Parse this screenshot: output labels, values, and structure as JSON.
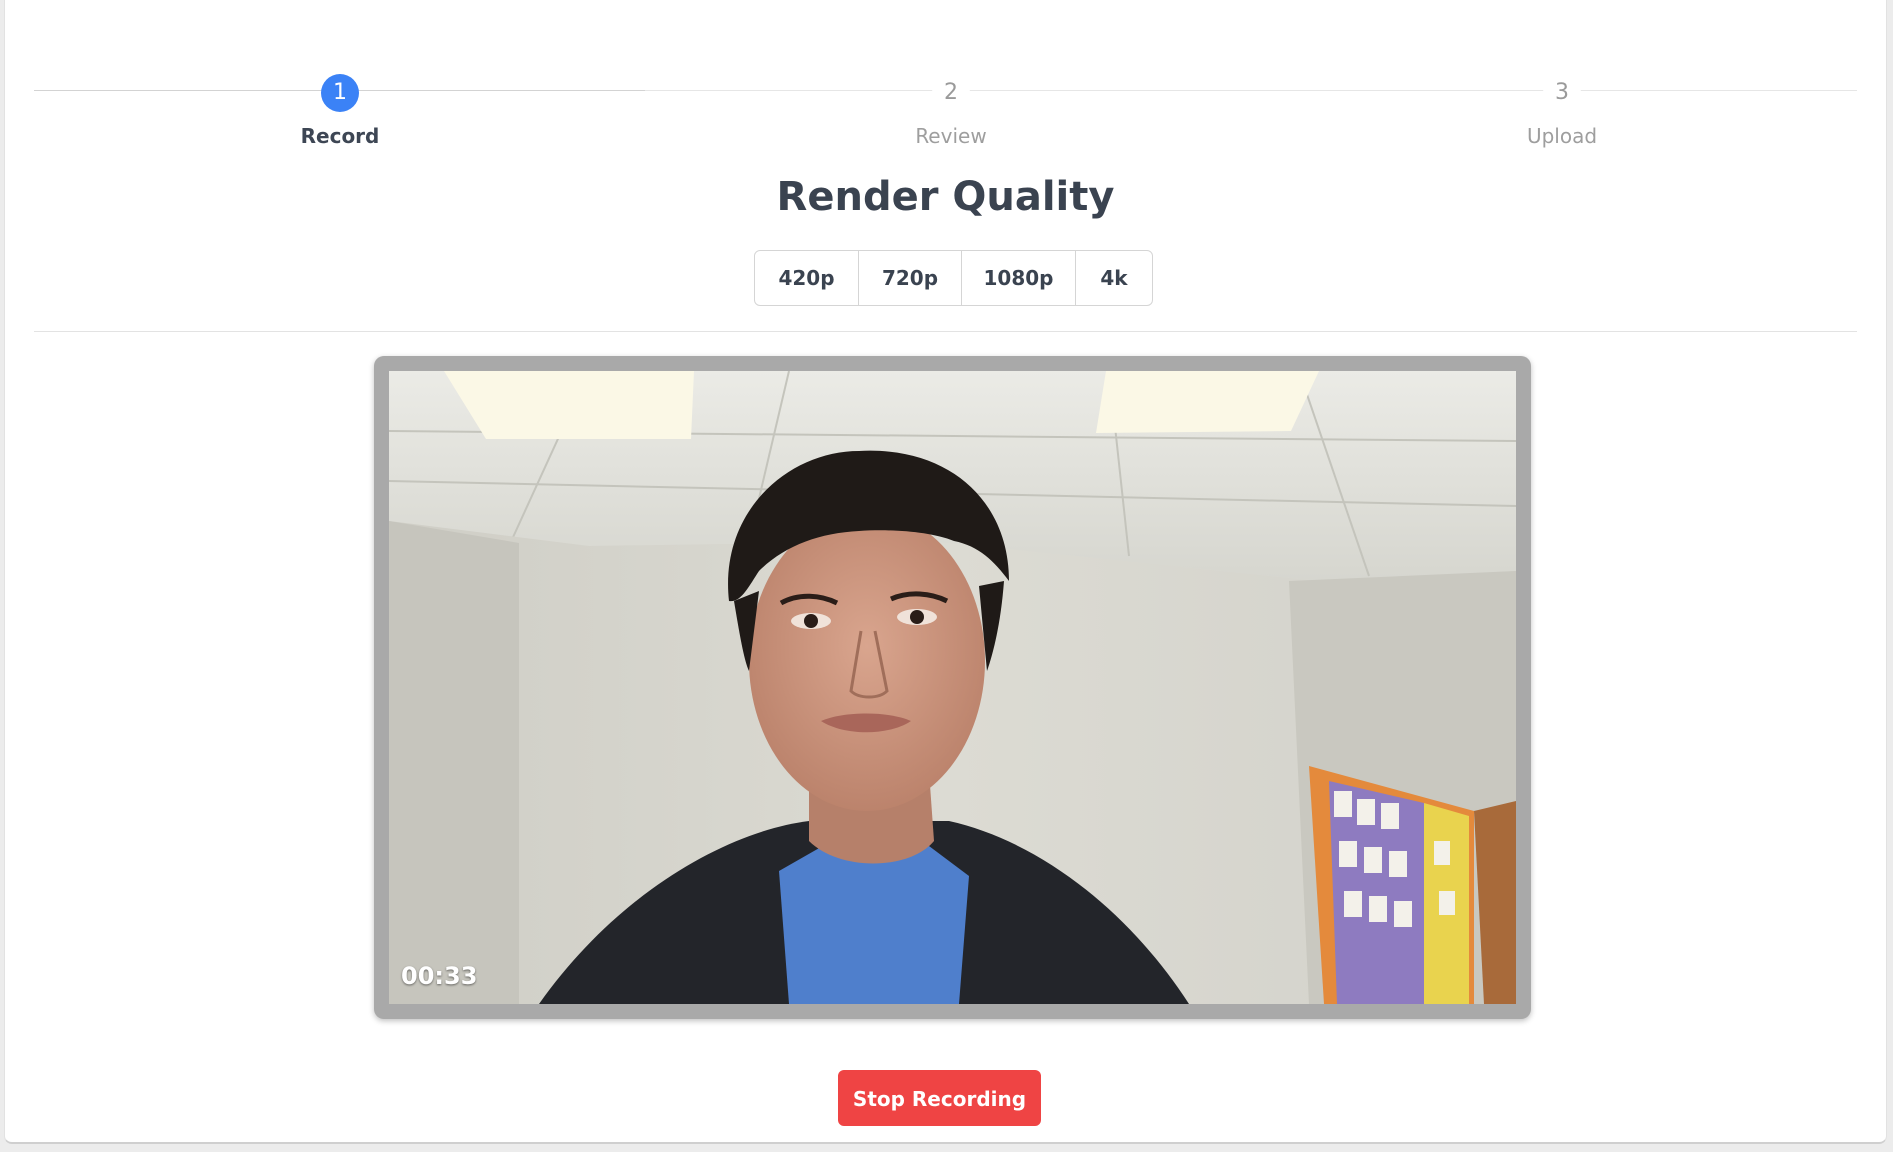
{
  "stepper": {
    "steps": [
      {
        "number": "1",
        "label": "Record",
        "active": true
      },
      {
        "number": "2",
        "label": "Review",
        "active": false
      },
      {
        "number": "3",
        "label": "Upload",
        "active": false
      }
    ]
  },
  "quality": {
    "title": "Render Quality",
    "options": [
      "420p",
      "720p",
      "1080p",
      "4k"
    ]
  },
  "video": {
    "timer": "00:33"
  },
  "actions": {
    "stop_label": "Stop Recording"
  },
  "colors": {
    "accent": "#3b82f6",
    "danger": "#ef4444",
    "text": "#3a4350"
  }
}
